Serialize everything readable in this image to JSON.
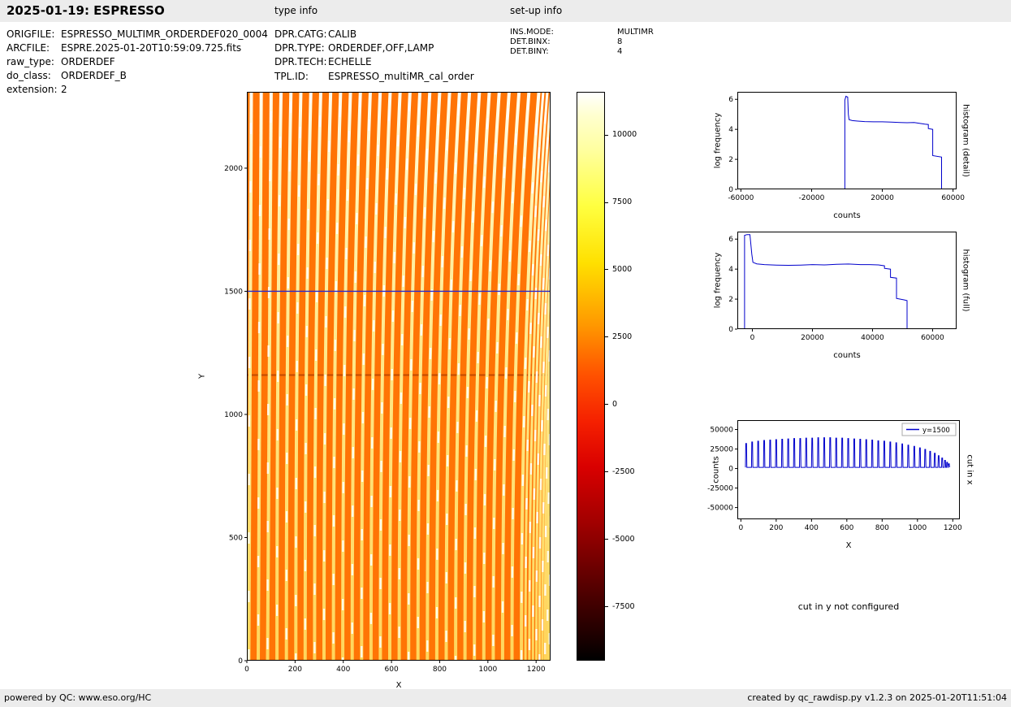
{
  "header": {
    "title": "2025-01-19: ESPRESSO",
    "type_info_label": "type info",
    "setup_info_label": "set-up info"
  },
  "file_info": {
    "rows": [
      {
        "label": "ORIGFILE:",
        "value": "ESPRESSO_MULTIMR_ORDERDEF020_0004"
      },
      {
        "label": "ARCFILE:",
        "value": "ESPRE.2025-01-20T10:59:09.725.fits"
      },
      {
        "label": "raw_type:",
        "value": "ORDERDEF"
      },
      {
        "label": "do_class:",
        "value": "ORDERDEF_B"
      },
      {
        "label": "extension:",
        "value": "2"
      }
    ]
  },
  "type_info": {
    "rows": [
      {
        "label": "DPR.CATG:",
        "value": "CALIB"
      },
      {
        "label": "DPR.TYPE:",
        "value": "ORDERDEF,OFF,LAMP"
      },
      {
        "label": "DPR.TECH:",
        "value": "ECHELLE"
      },
      {
        "label": "TPL.ID:",
        "value": "ESPRESSO_multiMR_cal_order"
      }
    ]
  },
  "setup_info": {
    "rows": [
      {
        "label": "INS.MODE:",
        "value": "MULTIMR"
      },
      {
        "label": "DET.BINX:",
        "value": "8"
      },
      {
        "label": "DET.BINY:",
        "value": "4"
      }
    ]
  },
  "notes": {
    "cut_y": "cut in y not configured"
  },
  "footer": {
    "left": "powered by QC: www.eso.org/HC",
    "right": "created by qc_rawdisp.py v1.2.3 on 2025-01-20T11:51:04"
  },
  "chart_data": [
    {
      "id": "raw_frame",
      "type": "heatmap",
      "description": "ESPRESSO echelle order-definition raw frame: bright curved vertical order stripes on orange background",
      "xlabel": "X",
      "ylabel": "Y",
      "xlim": [
        0,
        1260
      ],
      "ylim": [
        0,
        2310
      ],
      "xticks": [
        0,
        200,
        400,
        600,
        800,
        1000,
        1200
      ],
      "yticks": [
        0,
        500,
        1000,
        1500,
        2000
      ],
      "colors": {
        "background": "#ff7405",
        "dark_row": "#c24a00",
        "stripe_bright": "#fff3b0"
      },
      "orders": {
        "x_base": [
          8,
          47,
          86,
          125,
          164,
          203,
          242,
          281,
          320,
          359,
          398,
          437,
          476,
          515,
          554,
          593,
          632,
          671,
          710,
          749,
          788,
          827,
          866,
          905,
          944,
          983,
          1022,
          1061,
          1100,
          1139
        ],
        "x_extra": [
          1156,
          1172,
          1187,
          1201,
          1214,
          1226,
          1237,
          1247,
          1256
        ],
        "curve_min_shift": 10,
        "curve_shift_factor": 0.055
      },
      "dark_row_y": 1160,
      "cut_line": {
        "y": 1500,
        "color": "#2929cc"
      },
      "colorbar": {
        "colormap": "hot",
        "vmin": -9500,
        "vmax": 11600,
        "ticks": [
          10000,
          7500,
          5000,
          2500,
          0,
          -2500,
          -5000,
          -7500
        ]
      }
    },
    {
      "id": "histogram_detail",
      "type": "line",
      "side_label": "histogram (detail)",
      "xlabel": "counts",
      "ylabel": "log frequency",
      "xlim": [
        -62000,
        62000
      ],
      "ylim": [
        0,
        6.5
      ],
      "xticks": [
        -60000,
        -20000,
        20000,
        60000
      ],
      "yticks": [
        0,
        2,
        4,
        6
      ],
      "series": [
        {
          "name": "histogram",
          "color": "#0000cc",
          "points": [
            [
              -1200,
              0
            ],
            [
              -1200,
              5.95
            ],
            [
              -600,
              6.2
            ],
            [
              400,
              6.15
            ],
            [
              800,
              5.0
            ],
            [
              1200,
              4.65
            ],
            [
              3000,
              4.58
            ],
            [
              6000,
              4.55
            ],
            [
              10000,
              4.52
            ],
            [
              15000,
              4.5
            ],
            [
              20000,
              4.5
            ],
            [
              25000,
              4.48
            ],
            [
              30000,
              4.46
            ],
            [
              34000,
              4.44
            ],
            [
              38000,
              4.45
            ],
            [
              41000,
              4.4
            ],
            [
              44000,
              4.35
            ],
            [
              46000,
              4.32
            ],
            [
              46000,
              4.05
            ],
            [
              48500,
              4.0
            ],
            [
              48500,
              2.25
            ],
            [
              53500,
              2.15
            ],
            [
              53500,
              0
            ]
          ]
        }
      ]
    },
    {
      "id": "histogram_full",
      "type": "line",
      "side_label": "histogram (full)",
      "xlabel": "counts",
      "ylabel": "log frequency",
      "xlim": [
        -5000,
        68000
      ],
      "ylim": [
        0,
        6.5
      ],
      "xticks": [
        0,
        20000,
        40000,
        60000
      ],
      "yticks": [
        0,
        2,
        4,
        6
      ],
      "series": [
        {
          "name": "histogram",
          "color": "#0000cc",
          "points": [
            [
              -2600,
              0
            ],
            [
              -2600,
              6.25
            ],
            [
              -1800,
              6.3
            ],
            [
              -800,
              6.3
            ],
            [
              -200,
              5.0
            ],
            [
              200,
              4.45
            ],
            [
              1500,
              4.35
            ],
            [
              4000,
              4.3
            ],
            [
              8000,
              4.27
            ],
            [
              12000,
              4.25
            ],
            [
              16000,
              4.27
            ],
            [
              20000,
              4.3
            ],
            [
              24000,
              4.28
            ],
            [
              28000,
              4.32
            ],
            [
              32000,
              4.34
            ],
            [
              36000,
              4.3
            ],
            [
              39000,
              4.3
            ],
            [
              42000,
              4.28
            ],
            [
              44000,
              4.22
            ],
            [
              44000,
              4.05
            ],
            [
              46000,
              4.0
            ],
            [
              46000,
              3.45
            ],
            [
              48000,
              3.4
            ],
            [
              48000,
              2.05
            ],
            [
              50500,
              1.95
            ],
            [
              51500,
              1.9
            ],
            [
              51500,
              0
            ]
          ]
        }
      ]
    },
    {
      "id": "cut_in_x",
      "type": "line",
      "side_label": "cut in x",
      "xlabel": "X",
      "ylabel": "counts",
      "xlim": [
        -20,
        1240
      ],
      "ylim": [
        -65000,
        62000
      ],
      "xticks": [
        0,
        200,
        400,
        600,
        800,
        1000,
        1200
      ],
      "yticks": [
        -50000,
        -25000,
        0,
        25000,
        50000
      ],
      "legend": {
        "label": "y=1500",
        "color": "#0000cc",
        "position": "upper right"
      },
      "series": [
        {
          "name": "y=1500",
          "color": "#0000cc",
          "style": "spikes",
          "baseline": 1500,
          "peaks": [
            [
              30,
              32000
            ],
            [
              64,
              34000
            ],
            [
              98,
              35000
            ],
            [
              132,
              36000
            ],
            [
              166,
              36500
            ],
            [
              200,
              37000
            ],
            [
              234,
              37500
            ],
            [
              268,
              38000
            ],
            [
              302,
              38500
            ],
            [
              336,
              38500
            ],
            [
              370,
              39000
            ],
            [
              404,
              39000
            ],
            [
              438,
              39500
            ],
            [
              472,
              39500
            ],
            [
              506,
              39500
            ],
            [
              540,
              39000
            ],
            [
              574,
              39000
            ],
            [
              608,
              38500
            ],
            [
              642,
              38000
            ],
            [
              676,
              37500
            ],
            [
              710,
              37000
            ],
            [
              744,
              36500
            ],
            [
              778,
              35500
            ],
            [
              812,
              35000
            ],
            [
              846,
              34000
            ],
            [
              880,
              33000
            ],
            [
              914,
              31500
            ],
            [
              948,
              30000
            ],
            [
              982,
              28500
            ],
            [
              1014,
              26500
            ],
            [
              1044,
              24500
            ],
            [
              1072,
              22000
            ],
            [
              1098,
              19500
            ],
            [
              1120,
              16500
            ],
            [
              1140,
              13500
            ],
            [
              1156,
              10500
            ],
            [
              1168,
              8000
            ],
            [
              1178,
              6000
            ]
          ]
        }
      ]
    }
  ]
}
